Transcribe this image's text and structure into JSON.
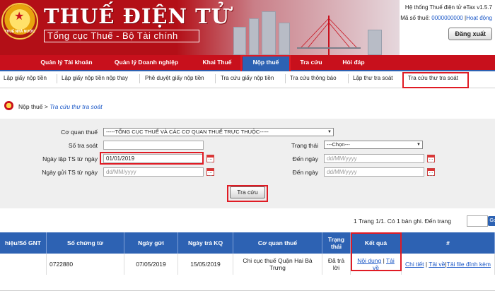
{
  "header": {
    "brand_title": "THUẾ ĐIỆN TỬ",
    "brand_subtitle": "Tổng cục Thuế - Bộ Tài chính",
    "emblem_text": "THUẾ NHÀ NƯỚC",
    "system_label": "Hệ thống Thuế điện tử eTax v1.5.7",
    "tax_code_label": "Mã số thuế:",
    "tax_code_value": "0000000000",
    "help_link": "Hoạt động",
    "logout_label": "Đăng xuất"
  },
  "main_nav": {
    "items": [
      {
        "label": "Quản lý Tài khoản"
      },
      {
        "label": "Quản lý Doanh nghiệp"
      },
      {
        "label": "Khai Thuế"
      },
      {
        "label": "Nộp thuế"
      },
      {
        "label": "Tra cứu"
      },
      {
        "label": "Hỏi đáp"
      }
    ],
    "active": "Nộp thuế"
  },
  "sub_nav": {
    "items": [
      {
        "label": "Lập giấy nộp tiền"
      },
      {
        "label": "Lập giấy nộp tiền nộp thay"
      },
      {
        "label": "Phê duyệt giấy nộp tiền"
      },
      {
        "label": "Tra cứu giấy nộp tiền"
      },
      {
        "label": "Tra cứu thông báo"
      },
      {
        "label": "Lập thư tra soát"
      },
      {
        "label": "Tra cứu thư tra soát"
      }
    ],
    "active": "Tra cứu thư tra soát"
  },
  "breadcrumb": {
    "parent": "Nộp thuế",
    "separator": ">",
    "current": "Tra cứu thư tra soát"
  },
  "form": {
    "agency_label": "Cơ quan thuế",
    "agency_value": "-----TỔNG CỤC THUẾ VÀ CÁC CƠ QUAN THUẾ TRỰC THUỘC-----",
    "ref_no_label": "Số tra soát",
    "ref_no_value": "",
    "status_label": "Trạng thái",
    "status_value": "---Chọn---",
    "created_from_label": "Ngày lập TS từ ngày",
    "created_from_value": "01/01/2019",
    "created_to_label": "Đến ngày",
    "created_to_placeholder": "dd/MM/yyyy",
    "sent_from_label": "Ngày gửi TS từ ngày",
    "sent_from_placeholder": "dd/MM/yyyy",
    "sent_to_label": "Đến ngày",
    "sent_to_placeholder": "dd/MM/yyyy",
    "search_button": "Tra cứu"
  },
  "pager": {
    "text": "1  Trang 1/1. Có 1 bản ghi. Đến trang",
    "go_label": "Go"
  },
  "table": {
    "columns": [
      "hiệu/Số GNT",
      "Số chứng từ",
      "Ngày gửi",
      "Ngày trả KQ",
      "Cơ quan thuế",
      "Trạng thái",
      "Kết quả",
      "#"
    ],
    "rows": [
      {
        "gnt": "",
        "voucher_no": "0722880",
        "sent_date": "07/05/2019",
        "result_date": "15/05/2019",
        "agency": "Chi cục thuế Quận Hai Bà Trưng",
        "status": "Đã trả lời",
        "result_links": [
          "Nội dung",
          "Tải về"
        ],
        "action_links": [
          "Chi tiết",
          "Tải về",
          "Tải file đính kèm"
        ]
      }
    ]
  }
}
